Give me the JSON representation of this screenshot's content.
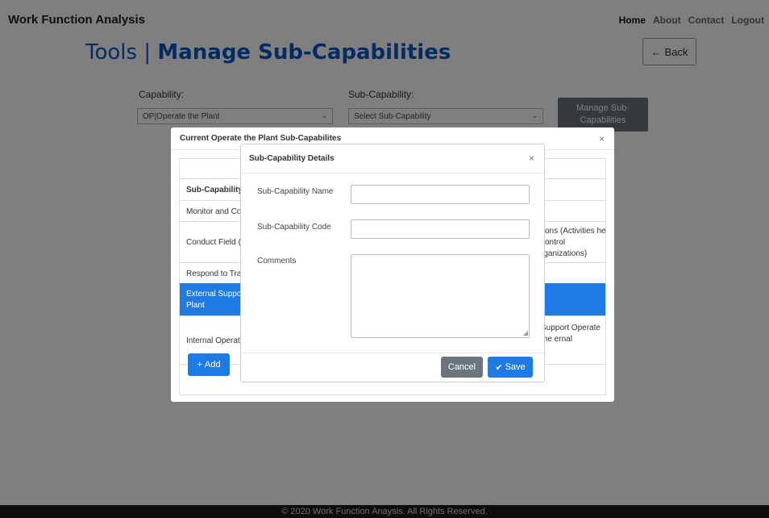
{
  "app": {
    "title": "Work Function Analysis",
    "nav": [
      "Home",
      "About",
      "Contact",
      "Logout"
    ],
    "active_nav": "Home"
  },
  "page": {
    "title_light": "Tools | ",
    "title_bold": "Manage Sub-Capabilities",
    "back_label": "Back",
    "back_icon": "arrow-left-icon"
  },
  "filters": {
    "capability_label": "Capability:",
    "capability_value": "OP|Operate the Plant",
    "subcapability_label": "Sub-Capability:",
    "subcapability_value": "Select Sub-Capability",
    "manage_label": "Manage Sub-Capabilities"
  },
  "list_modal": {
    "title": "Current Operate the Plant Sub-Capabilites",
    "column_header": "Sub-Capability",
    "rows": [
      {
        "name": "Monitor and Co",
        "desc": ""
      },
      {
        "name": "Conduct Field (",
        "desc": "tions (Activities he control rganizations)"
      },
      {
        "name": "Respond to Tra",
        "desc": ""
      },
      {
        "name": "External Suppo Plant",
        "desc": ""
      },
      {
        "name": "Internal Operat",
        "desc": "Support Operate the ernal"
      }
    ],
    "selected_row": 3,
    "add_label": "Add",
    "add_icon": "plus-icon"
  },
  "details_modal": {
    "title": "Sub-Capability Details",
    "name_label": "Sub-Capability Name",
    "name_value": "",
    "code_label": "Sub-Capability Code",
    "code_value": "",
    "comments_label": "Comments",
    "comments_value": "",
    "cancel_label": "Cancel",
    "save_label": "Save",
    "save_icon": "check-icon"
  },
  "footer": {
    "text": "© 2020 Work Function Anaysis. All Rights Reserved."
  },
  "colors": {
    "primary": "#1e7be4",
    "title_blue": "#0b57c7",
    "secondary": "#6c757d",
    "overlay": "rgba(0,0,0,0.5)"
  }
}
